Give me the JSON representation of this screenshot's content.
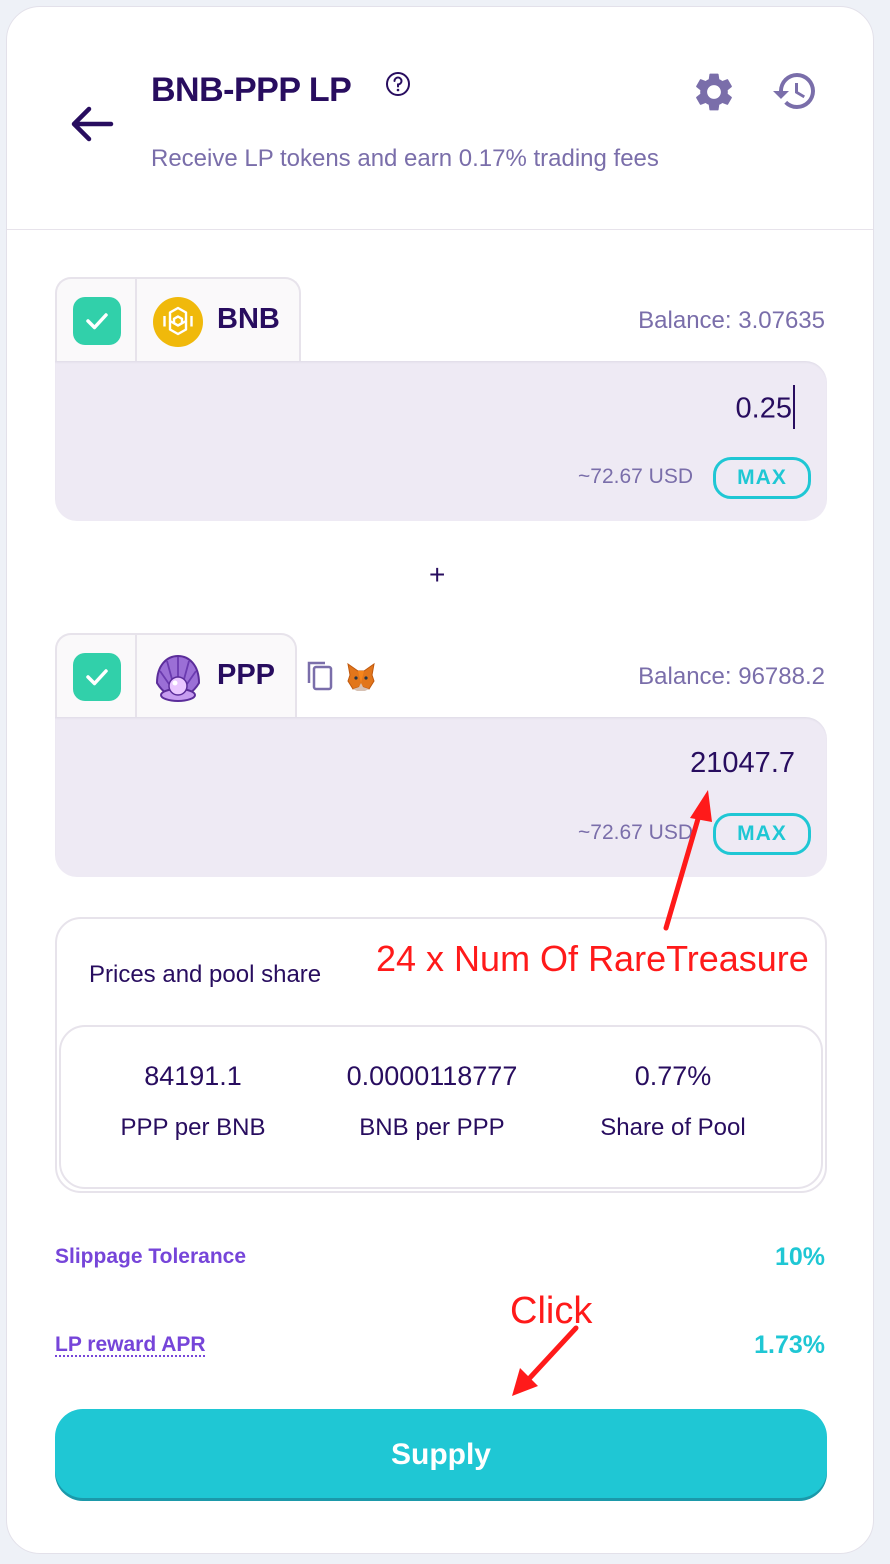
{
  "header": {
    "title": "BNB-PPP LP",
    "subtitle": "Receive LP tokens and earn 0.17% trading fees"
  },
  "token_a": {
    "symbol": "BNB",
    "balance": "Balance: 3.07635",
    "amount": "0.25",
    "usd": "~72.67 USD",
    "max_label": "MAX",
    "logo_color": "#f0b90b"
  },
  "plus_sign": "+",
  "token_b": {
    "symbol": "PPP",
    "balance": "Balance: 96788.2",
    "amount": "21047.7",
    "usd": "~72.67 USD",
    "max_label": "MAX",
    "logo_color": "#a37bd6"
  },
  "prices": {
    "title": "Prices and pool share",
    "stats": [
      {
        "value": "84191.1",
        "label": "PPP per BNB"
      },
      {
        "value": "0.0000118777",
        "label": "BNB per PPP"
      },
      {
        "value": "0.77%",
        "label": "Share of Pool"
      }
    ]
  },
  "slippage": {
    "label": "Slippage Tolerance",
    "value": "10%"
  },
  "apr": {
    "label": "LP reward APR",
    "value": "1.73%"
  },
  "supply_label": "Supply",
  "annotations": {
    "treasure_note": "24 x Num Of RareTreasure",
    "click_note": "Click",
    "color": "#ff1a1a"
  },
  "colors": {
    "primary_text": "#280d5f",
    "secondary_text": "#7a6eaa",
    "accent": "#1fc7d4",
    "success": "#31d0aa",
    "purple": "#7645d9"
  }
}
